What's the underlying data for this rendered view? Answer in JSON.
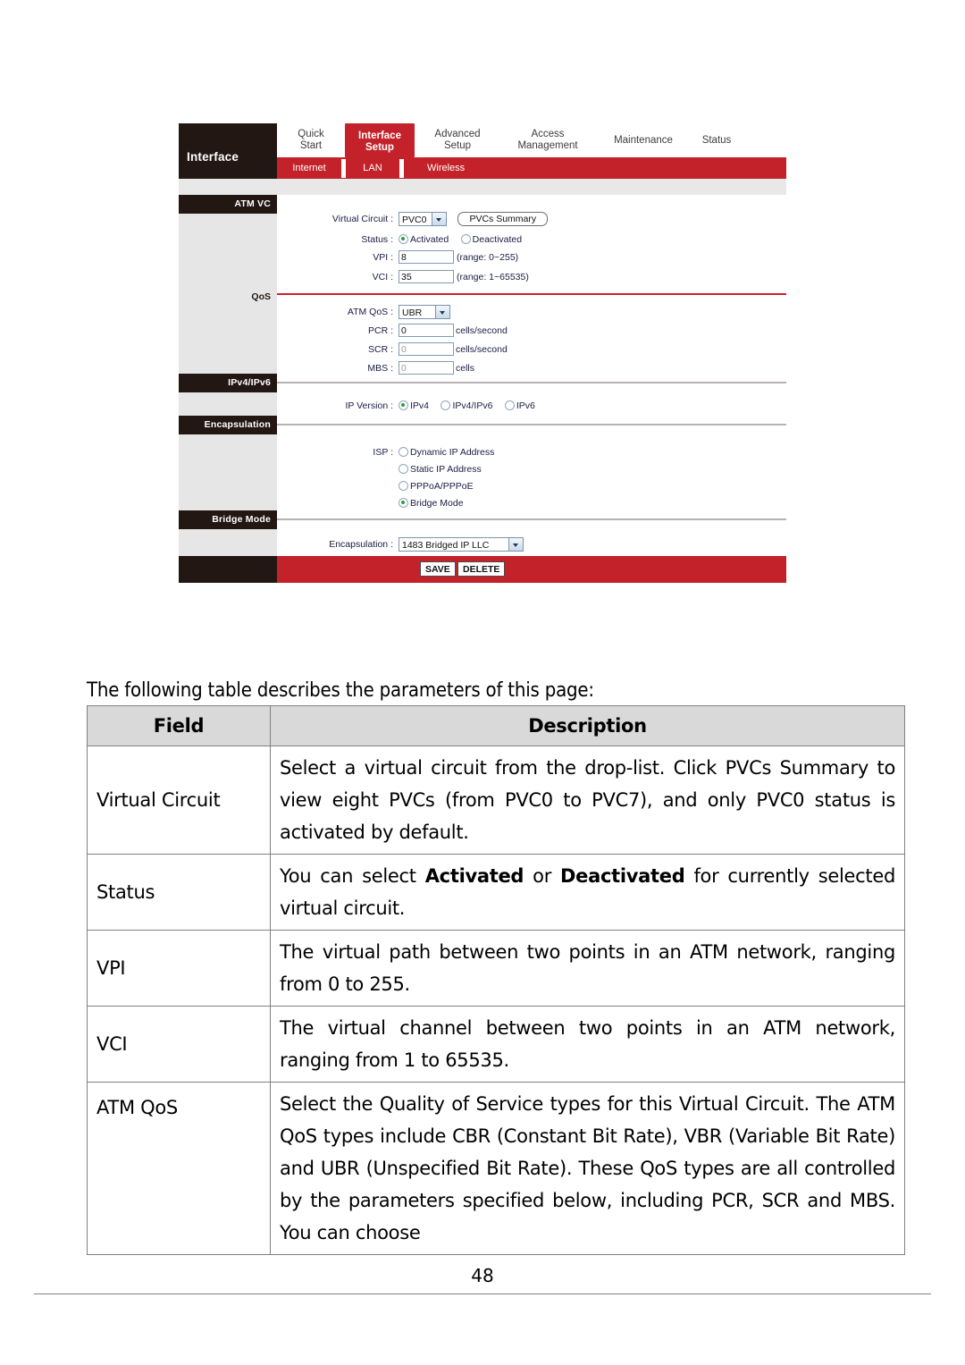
{
  "router": {
    "brand": "Interface",
    "main_tabs": [
      {
        "label": "Quick\nStart",
        "active": false
      },
      {
        "label": "Interface\nSetup",
        "active": true
      },
      {
        "label": "Advanced\nSetup",
        "active": false
      },
      {
        "label": "Access\nManagement",
        "active": false
      },
      {
        "label": "Maintenance",
        "active": false
      },
      {
        "label": "Status",
        "active": false
      }
    ],
    "sub_tabs": [
      {
        "label": "Internet",
        "active": true
      },
      {
        "label": "LAN",
        "active": false
      },
      {
        "label": "Wireless",
        "active": false
      }
    ],
    "sections": {
      "atm_vc": "ATM VC",
      "qos": "QoS",
      "ipv4_ipv6": "IPv4/IPv6",
      "encapsulation": "Encapsulation",
      "bridge_mode": "Bridge Mode"
    },
    "fields": {
      "virtual_circuit_label": "Virtual Circuit :",
      "virtual_circuit_value": "PVC0",
      "pvcs_summary_button": "PVCs Summary",
      "status_label": "Status :",
      "status_activated": "Activated",
      "status_deactivated": "Deactivated",
      "vpi_label": "VPI :",
      "vpi_value": "8",
      "vpi_range": "(range: 0~255)",
      "vci_label": "VCI :",
      "vci_value": "35",
      "vci_range": "(range: 1~65535)",
      "atm_qos_label": "ATM QoS :",
      "atm_qos_value": "UBR",
      "pcr_label": "PCR :",
      "pcr_value": "0",
      "pcr_unit": "cells/second",
      "scr_label": "SCR :",
      "scr_value": "0",
      "scr_unit": "cells/second",
      "mbs_label": "MBS :",
      "mbs_value": "0",
      "mbs_unit": "cells",
      "ip_version_label": "IP Version :",
      "ip_version_options": [
        "IPv4",
        "IPv4/IPv6",
        "IPv6"
      ],
      "isp_label": "ISP :",
      "isp_options": [
        "Dynamic IP Address",
        "Static IP Address",
        "PPPoA/PPPoE",
        "Bridge Mode"
      ],
      "encapsulation_label": "Encapsulation :",
      "encapsulation_value": "1483 Bridged IP LLC"
    },
    "actions": {
      "save": "SAVE",
      "delete": "DELETE"
    },
    "colors": {
      "red": "#c4222a",
      "dark": "#231714",
      "sidebar": "#e6e6e6",
      "divider_red": "#cf2030",
      "divider_gray": "#b9b2b2"
    }
  },
  "document": {
    "intro": "The following table describes the parameters of this page:",
    "table": {
      "headers": [
        "Field",
        "Description"
      ],
      "rows": [
        {
          "field": "Virtual Circuit",
          "description": "Select a virtual circuit from the drop-list. Click PVCs Summary to view eight PVCs (from PVC0 to PVC7), and only PVC0 status is activated by default."
        },
        {
          "field": "Status",
          "description_pre": "You can select ",
          "description_b1": "Activated",
          "description_mid": " or ",
          "description_b2": "Deactivated",
          "description_post": " for currently selected virtual circuit."
        },
        {
          "field": "VPI",
          "description": "The virtual path between two points in an ATM network, ranging from 0 to 255."
        },
        {
          "field": "VCI",
          "description": "The virtual channel between two points in an ATM network, ranging from 1 to 65535."
        },
        {
          "field": "ATM QoS",
          "description": "Select the Quality of Service types for this Virtual Circuit. The ATM QoS types include CBR (Constant Bit Rate), VBR (Variable Bit Rate) and UBR (Unspecified Bit Rate). These QoS types are all controlled by the parameters specified below, including PCR, SCR and MBS. You can choose"
        }
      ]
    },
    "page_number": "48"
  }
}
